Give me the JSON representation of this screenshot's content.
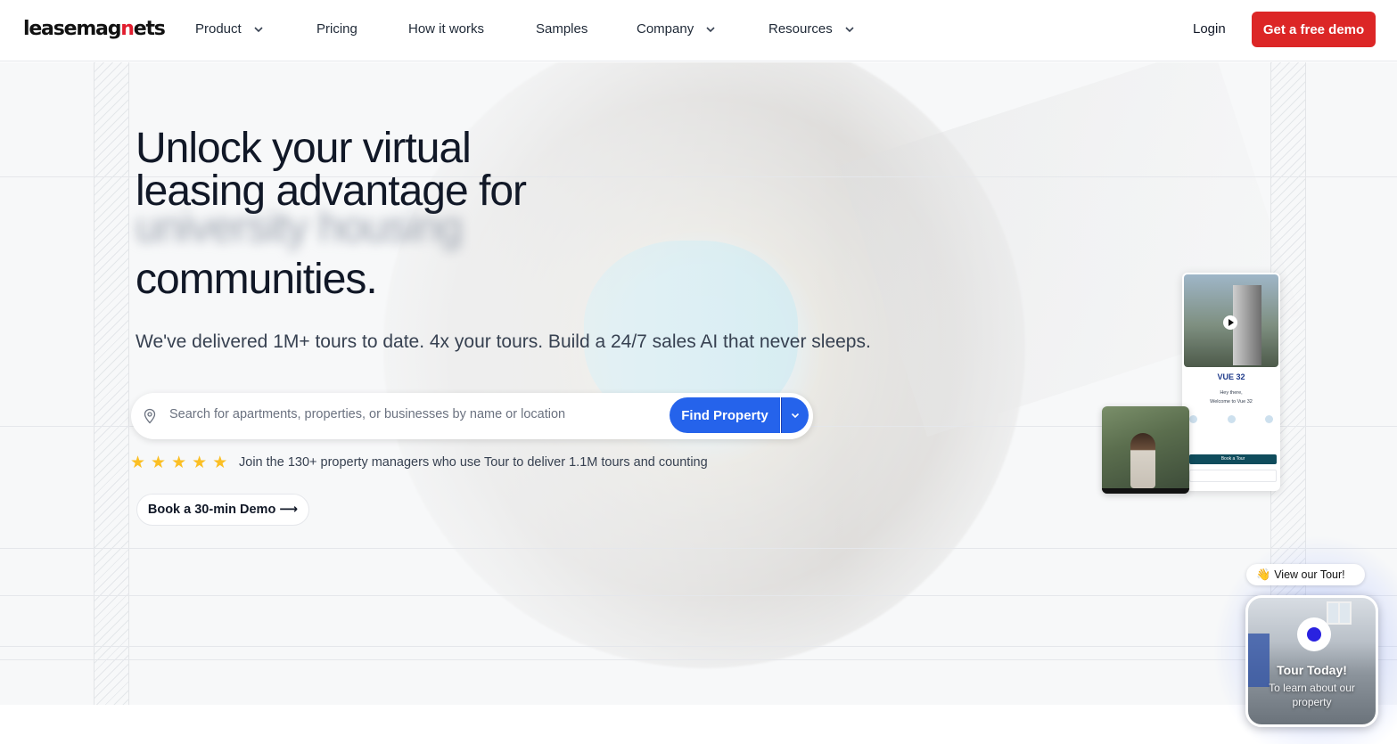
{
  "nav": {
    "logo_prefix": "leasemag",
    "logo_accent": "n",
    "logo_suffix": "ets",
    "items": [
      {
        "label": "Product",
        "dropdown": true
      },
      {
        "label": "Pricing",
        "dropdown": false
      },
      {
        "label": "How it works",
        "dropdown": false
      },
      {
        "label": "Samples",
        "dropdown": false
      },
      {
        "label": "Company",
        "dropdown": true
      },
      {
        "label": "Resources",
        "dropdown": true
      }
    ],
    "login_label": "Login",
    "demo_label": "Get a free demo"
  },
  "hero": {
    "headline_line1": "Unlock your virtual",
    "headline_line2": "leasing advantage for",
    "headline_blurred": "university housing",
    "headline_line3": "communities.",
    "subtitle": "We've delivered 1M+ tours to date. 4x your tours. Build a 24/7 sales AI that never sleeps.",
    "search": {
      "placeholder": "Search for apartments, properties, or businesses by name or location",
      "button_label": "Find Property"
    },
    "rating": 5,
    "social_proof": "Join the 130+ property managers who use Tour to deliver 1.1M tours and counting",
    "book_demo_label": "Book a 30-min Demo ⟶"
  },
  "phone_mockup": {
    "brand": "VUE 32",
    "greeting": "Hey there,",
    "welcome": "Welcome to Vue 32",
    "book_label": "Book a Tour"
  },
  "tour_widget": {
    "pill_emoji": "👋",
    "pill_label": "View our Tour!",
    "title": "Tour Today!",
    "subtitle": "To learn about our property"
  },
  "colors": {
    "brand_red": "#dc2626",
    "primary_blue": "#2563eb",
    "star": "#fbbf24"
  }
}
